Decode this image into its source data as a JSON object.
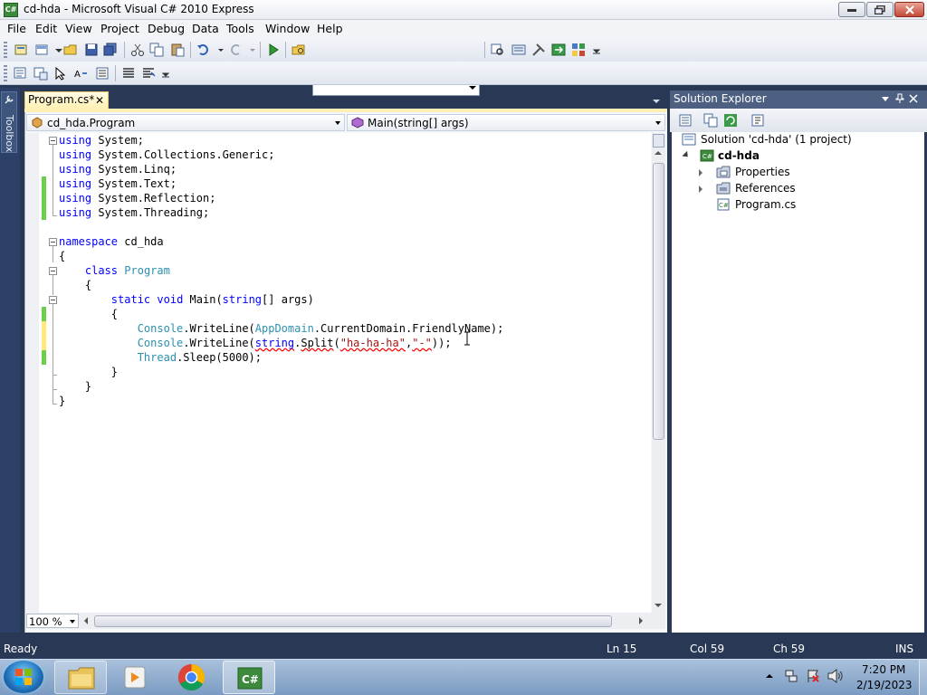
{
  "window": {
    "title": "cd-hda - Microsoft Visual C# 2010 Express",
    "app_icon_text": "C#"
  },
  "menu": {
    "items": [
      "File",
      "Edit",
      "View",
      "Project",
      "Debug",
      "Data",
      "Tools",
      "Window",
      "Help"
    ]
  },
  "toolbar": {
    "solution_config_value": ""
  },
  "toolbox": {
    "label": "Toolbox"
  },
  "editor": {
    "tab_label": "Program.cs*",
    "tab_close": "✕",
    "class_dropdown": "cd_hda.Program",
    "member_dropdown": "Main(string[] args)",
    "zoom": "100 %",
    "code_lines": [
      "using System;",
      "using System.Collections.Generic;",
      "using System.Linq;",
      "using System.Text;",
      "using System.Reflection;",
      "using System.Threading;",
      "",
      "namespace cd_hda",
      "{",
      "    class Program",
      "    {",
      "        static void Main(string[] args)",
      "        {",
      "            Console.WriteLine(AppDomain.CurrentDomain.FriendlyName);",
      "            Console.WriteLine(string.Split(\"ha-ha-ha\",\"-\"));",
      "            Thread.Sleep(5000);",
      "        }",
      "    }",
      "}"
    ]
  },
  "solution_explorer": {
    "title": "Solution Explorer",
    "solution": "Solution 'cd-hda' (1 project)",
    "project": "cd-hda",
    "items": [
      "Properties",
      "References",
      "Program.cs"
    ]
  },
  "status": {
    "ready": "Ready",
    "line": "Ln 15",
    "col": "Col 59",
    "ch": "Ch 59",
    "mode": "INS"
  },
  "taskbar": {
    "time": "7:20 PM",
    "date": "2/19/2023"
  },
  "colors": {
    "keyword": "#0000ff",
    "type": "#2b91af",
    "string": "#a31515",
    "chrome_dark": "#293955",
    "tab_active": "#fff1b5"
  }
}
